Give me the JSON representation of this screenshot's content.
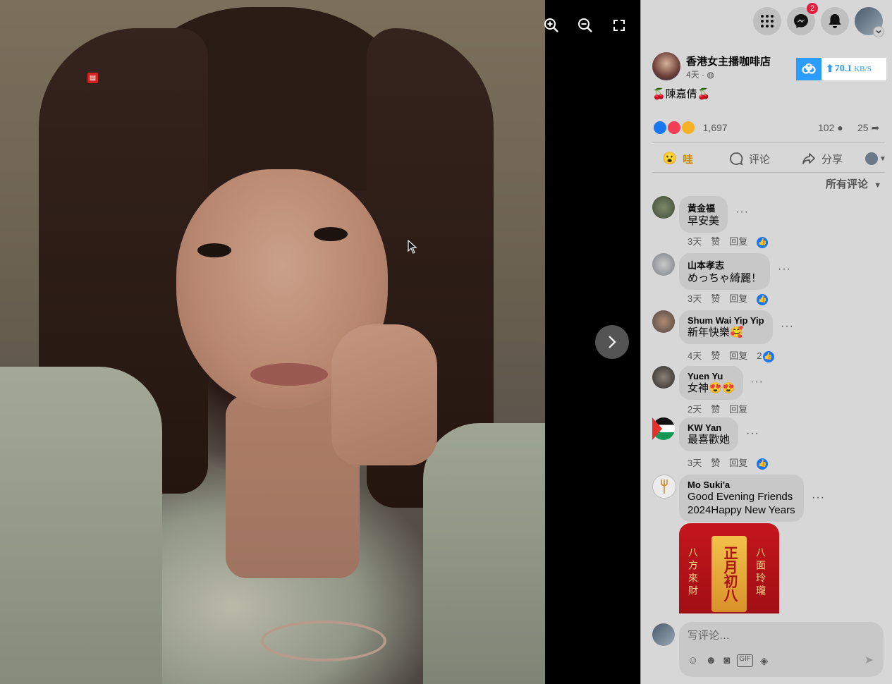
{
  "viewer": {
    "tools": [
      "zoom-in",
      "zoom-out",
      "fullscreen"
    ],
    "next_label": "›"
  },
  "topbar": {
    "messenger_badge": "2"
  },
  "post": {
    "page_name": "香港女主播咖啡店",
    "time": "4天 · ",
    "caption": "🍒陳嘉倩🍒",
    "reaction_count": "1,697",
    "comment_count": "102",
    "share_count": "25",
    "speed": {
      "value": "70.1",
      "unit": "KB/S"
    }
  },
  "actions": {
    "react_label": "哇",
    "comment_label": "评论",
    "share_label": "分享"
  },
  "sort_label": "所有评论",
  "comments": [
    {
      "name": "黄金福",
      "text": "早安美",
      "time": "3天",
      "like": "赞",
      "reply": "回复",
      "likes": ""
    },
    {
      "name": "山本孝志",
      "text": "めっちゃ綺麗！",
      "time": "3天",
      "like": "赞",
      "reply": "回复",
      "likes": ""
    },
    {
      "name": "Shum Wai Yip Yip",
      "text": "新年快樂🥰",
      "time": "4天",
      "like": "赞",
      "reply": "回复",
      "likes": "2"
    },
    {
      "name": "Yuen Yu",
      "text": "女神😍😍",
      "time": "2天",
      "like": "赞",
      "reply": "回复",
      "likes": ""
    },
    {
      "name": "KW Yan",
      "text": "最喜歡她",
      "time": "3天",
      "like": "赞",
      "reply": "回复",
      "likes": ""
    },
    {
      "name": "Mo Suki'a",
      "text": "Good Evening Friends",
      "text2": "2024Happy New Years"
    }
  ],
  "greeting": {
    "center": "正月初八",
    "left": "八方來財",
    "right": "八面玲瓏"
  },
  "compose": {
    "placeholder": "写评论…"
  },
  "colors": {
    "accent": "#1877f2",
    "badge": "#e41e3f",
    "speed": "#2a9dff"
  }
}
